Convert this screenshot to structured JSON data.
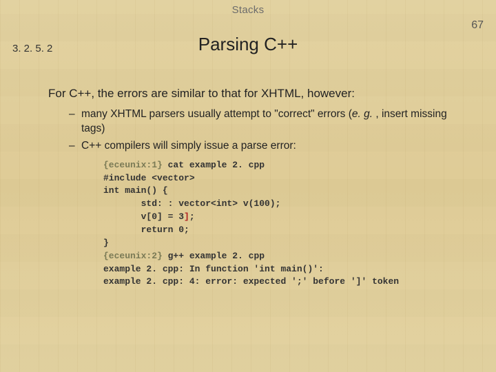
{
  "header": {
    "topic": "Stacks",
    "page_number": "67",
    "section_number": "3. 2. 5. 2",
    "title": "Parsing C++"
  },
  "body": {
    "lead": "For C++, the errors are similar to that for XHTML, however:",
    "bullets": [
      {
        "pre": "many XHTML parsers usually attempt to \"correct\" errors (",
        "em": "e. g.",
        "post": " , insert missing tags)"
      },
      {
        "pre": "C++ compilers will simply issue a parse error:",
        "em": "",
        "post": ""
      }
    ]
  },
  "code": {
    "l1_prompt": "{eceunix:1}",
    "l1_rest": " cat example 2. cpp",
    "l2": "#include <vector>",
    "l3": "int main() {",
    "l4": "       std: : vector<int> v(100);",
    "l5a": "       v[0] = 3",
    "l5b": "]",
    "l5c": ";",
    "l6": "       return 0;",
    "l7": "}",
    "l8_prompt": "{eceunix:2}",
    "l8_rest": " g++ example 2. cpp",
    "l9": "example 2. cpp: In function 'int main()':",
    "l10": "example 2. cpp: 4: error: expected ';' before ']' token"
  }
}
